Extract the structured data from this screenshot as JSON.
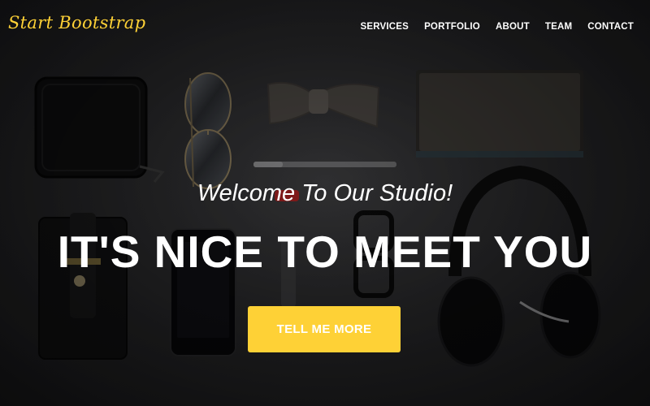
{
  "navbar": {
    "brand": "Start Bootstrap",
    "links": [
      "SERVICES",
      "PORTFOLIO",
      "ABOUT",
      "TEAM",
      "CONTACT"
    ]
  },
  "hero": {
    "subheading": "Welcome To Our Studio!",
    "heading": "IT'S NICE TO MEET YOU",
    "button_label": "TELL ME MORE"
  },
  "colors": {
    "accent": "#fed136",
    "background": "#2c2c2e",
    "text": "#ffffff"
  }
}
